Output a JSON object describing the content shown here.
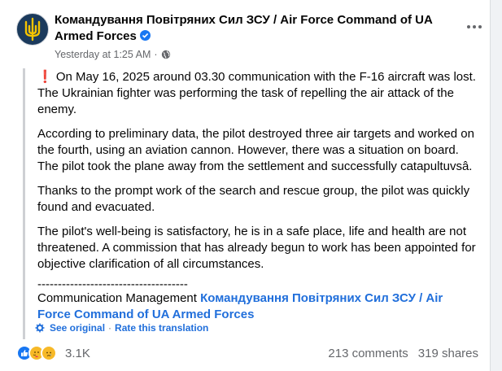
{
  "post": {
    "author": "Командування Повітряних Сил ЗСУ / Air Force Command of UA Armed Forces",
    "timestamp": "Yesterday at 1:25 AM",
    "separator": "·",
    "paragraphs": {
      "p1_rest": "On May 16, 2025 around 03.30 communication with the F-16 aircraft was lost. The Ukrainian fighter was performing the task of repelling the air attack of the enemy.",
      "p1_marker": "❗",
      "p2": "According to preliminary data, the pilot destroyed three air targets and worked on the fourth, using an aviation cannon. However, there was a situation on board. The pilot took the plane away from the settlement and successfully catapultuvsâ.",
      "p3": "Thanks to the prompt work of the search and rescue group, the pilot was quickly found and evacuated.",
      "p4": "The pilot's well-being is satisfactory, he is in a safe place, life and health are not threatened. A commission that has already begun to work has been appointed for objective clarification of all circumstances."
    },
    "divider": "-------------------------------------",
    "signature_prefix": "Communication Management",
    "signature_link": "Командування Повітряних Сил ЗСУ / Air Force Command of UA Armed Forces"
  },
  "translation": {
    "see_original": "See original",
    "middot": "·",
    "rate": "Rate this translation"
  },
  "footer": {
    "reaction_count": "3.1K",
    "comments": "213 comments",
    "shares": "319 shares",
    "reactions": [
      "like",
      "care",
      "sad"
    ]
  },
  "icons": {
    "avatar": "air-force-trident-logo",
    "verified": "verified-badge-icon",
    "privacy": "globe-icon",
    "more": "more-options-icon",
    "translate": "gear-icon"
  },
  "colors": {
    "link": "#216fdb",
    "verified": "#1877f2",
    "secondary_text": "#65676b",
    "quote_bar": "#ced0d4"
  }
}
